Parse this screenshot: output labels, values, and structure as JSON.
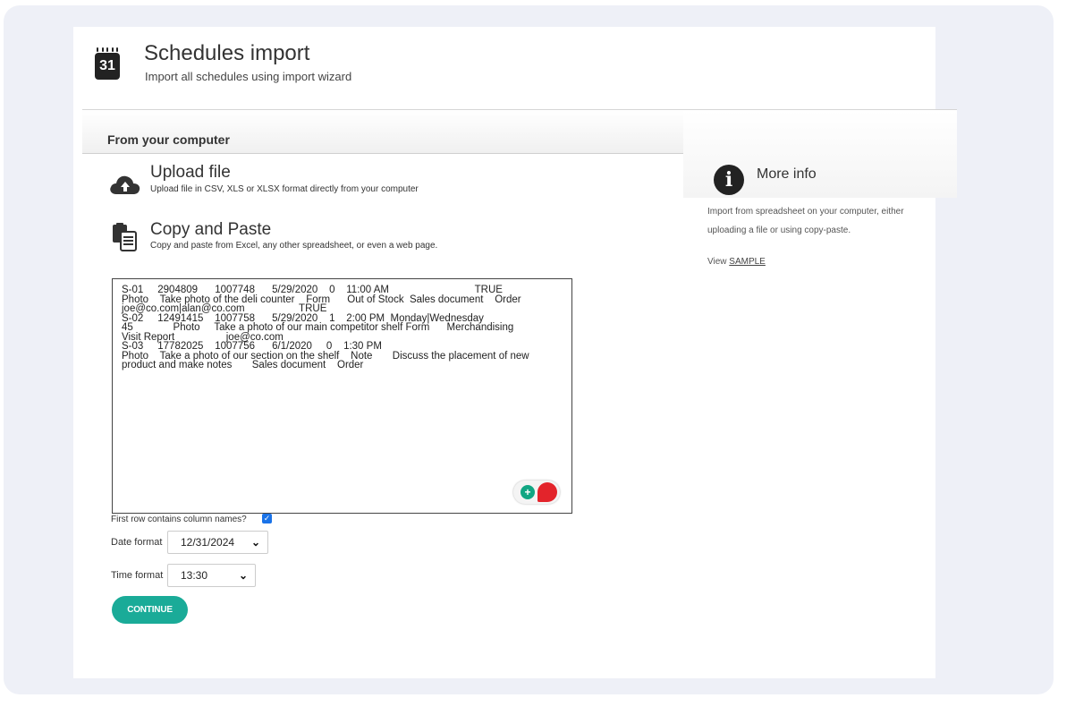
{
  "header": {
    "icon_day": "31",
    "title": "Schedules import",
    "subtitle": "Import all schedules using import wizard"
  },
  "section": {
    "title": "From your computer"
  },
  "upload": {
    "icon": "cloud-upload-icon",
    "title": "Upload file",
    "description": "Upload file in CSV, XLS or XLSX format directly from your computer"
  },
  "paste": {
    "icon": "paste-icon",
    "title": "Copy and Paste",
    "description": "Copy and paste from Excel, any other spreadsheet, or even a web page.",
    "lines": [
      "S-01     2904809      1007748      5/29/2020    0    11:00 AM                              TRUE",
      "Photo    Take photo of the deli counter    Form      Out of Stock  Sales document    Order",
      "joe@co.com|alan@co.com                   TRUE",
      "S-02     12491415    1007758      5/29/2020    1    2:00 PM  Monday|Wednesday",
      "45              Photo     Take a photo of our main competitor shelf Form      Merchandising",
      "Visit Report                  joe@co.com",
      "S-03     17782025    1007756      6/1/2020     0    1:30 PM",
      "Photo    Take a photo of our section on the shelf    Note       Discuss the placement of new",
      "product and make notes       Sales document    Order"
    ]
  },
  "options": {
    "first_row_label": "First row contains column names?",
    "first_row_checked": true,
    "date_format_label": "Date format",
    "date_format_value": "12/31/2024",
    "time_format_label": "Time format",
    "time_format_value": "13:30"
  },
  "continue_label": "CONTINUE",
  "info": {
    "icon": "info-icon",
    "title": "More info",
    "text": "Import from spreadsheet on your computer, either uploading a file or using copy-paste.",
    "view_prefix": "View",
    "sample_link": "SAMPLE"
  },
  "colors": {
    "accent": "#1aab98",
    "frame": "#eef0f7"
  }
}
